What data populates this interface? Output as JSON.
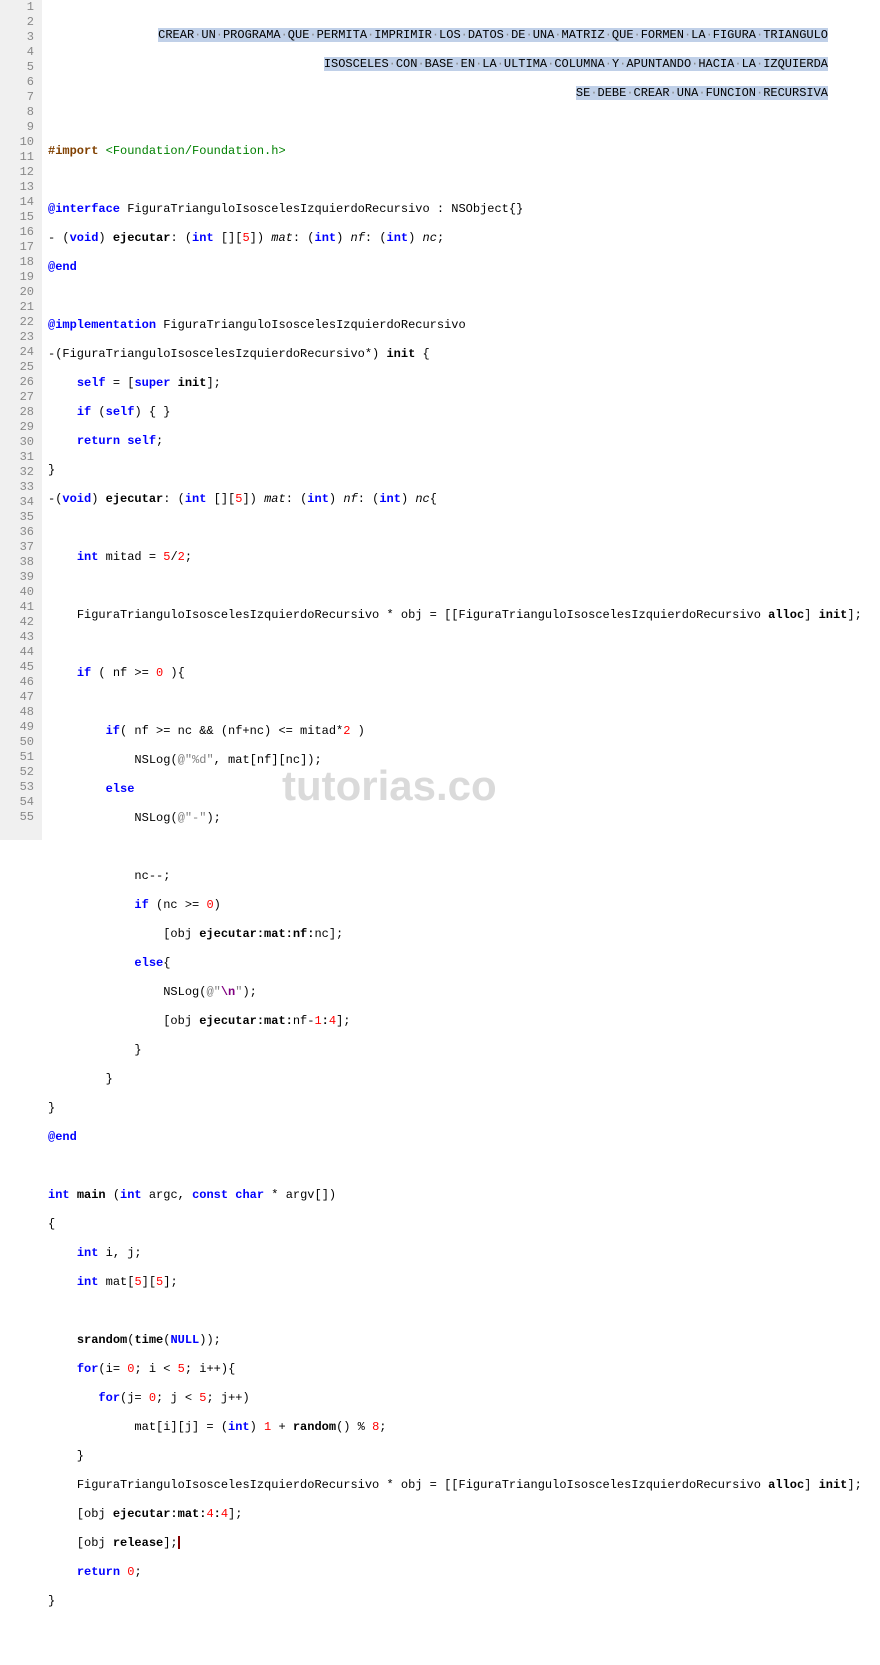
{
  "watermark": "tutorias.co",
  "comment_lines": [
    "CREAR·UN·PROGRAMA·QUE·PERMITA·IMPRIMIR·LOS·DATOS·DE·UNA·MATRIZ·QUE·FORMEN·LA·FIGURA·TRIANGULO",
    "ISOSCELES·CON·BASE·EN·LA·ULTIMA·COLUMNA·Y·APUNTANDO·HACIA·LA·IZQUIERDA",
    "SE·DEBE·CREAR·UNA·FUNCION·RECURSIVA"
  ],
  "tokens": {
    "import_dir": "#import",
    "foundation": "<Foundation/Foundation.h>",
    "at_interface": "@interface",
    "at_implementation": "@implementation",
    "at_end": "@end",
    "class_name": "FiguraTrianguloIsoscelesIzquierdoRecursivo",
    "nsobject": " : NSObject{}",
    "void": "void",
    "int": "int",
    "const": "const",
    "char": "char",
    "ejecutar": "ejecutar",
    "mat": "mat",
    "nf": "nf",
    "nc": "nc",
    "self": "self",
    "super": "super",
    "init": "init",
    "if": "if",
    "else": "else",
    "return": "return",
    "for": "for",
    "alloc": "alloc",
    "release": "release",
    "nslog": "NSLog",
    "main": "main",
    "argc": "argc",
    "argv": "argv",
    "srandom": "srandom",
    "time": "time",
    "null": "NULL",
    "random": "random",
    "mitad_label": "mitad",
    "mitad_expr": " = ",
    "obj": "obj",
    "str_d": "@\"%d\"",
    "str_dash": "@\"-\"",
    "str_nl_open": "@\"",
    "str_nl_esc": "\\n",
    "str_nl_close": "\""
  },
  "nums": {
    "n5": "5",
    "n2": "2",
    "n0": "0",
    "n1": "1",
    "n4": "4",
    "n8": "8"
  },
  "line_count": 55
}
